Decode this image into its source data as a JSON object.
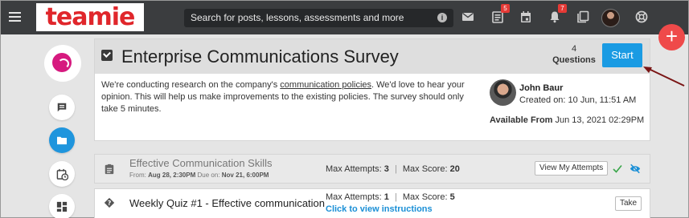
{
  "topbar": {
    "logo": "teamie",
    "search_placeholder": "Search for posts, lessons, assessments and more",
    "search_info_icon": "info-icon",
    "icons": [
      "mail-icon",
      "newsfeed-icon",
      "calendar-icon",
      "bell-icon",
      "pages-icon",
      "help-icon"
    ],
    "newsfeed_badge": "5",
    "notification_badge": "7"
  },
  "fab": {
    "label": "+"
  },
  "survey": {
    "title": "Enterprise Communications Survey",
    "question_count": "4",
    "question_label": "Questions",
    "start_label": "Start",
    "desc_before": "We're conducting research on the company's ",
    "desc_link": "communication policies",
    "desc_after": ". We'd love to hear your opinion. This will help us make improvements to the existing policies. The survey should only take 5 minutes.",
    "author_name": "John Baur",
    "created_on": "Created on: 10 Jun, 11:51 AM",
    "available_label": "Available From",
    "available_value": "Jun 13, 2021 02:29PM"
  },
  "rows": {
    "r1": {
      "title": "Effective Communication Skills",
      "from_label": "From:",
      "from_value": "Aug 28, 2:30PM",
      "due_label": "Due on:",
      "due_value": "Nov 21, 6:00PM",
      "attempts_label": "Max Attempts:",
      "attempts_value": "3",
      "score_label": "Max Score:",
      "score_value": "20",
      "button": "View My Attempts"
    },
    "r2": {
      "title": "Weekly Quiz #1 - Effective communication",
      "attempts_label": "Max Attempts:",
      "attempts_value": "1",
      "score_label": "Max Score:",
      "score_value": "5",
      "link": "Click to view instructions",
      "button": "Take"
    },
    "separator": "|"
  },
  "colors": {
    "topbar": "#3b3d3f",
    "accent": "#1a9be3",
    "fab": "#ef4a4a",
    "brand": "#e0262b"
  }
}
